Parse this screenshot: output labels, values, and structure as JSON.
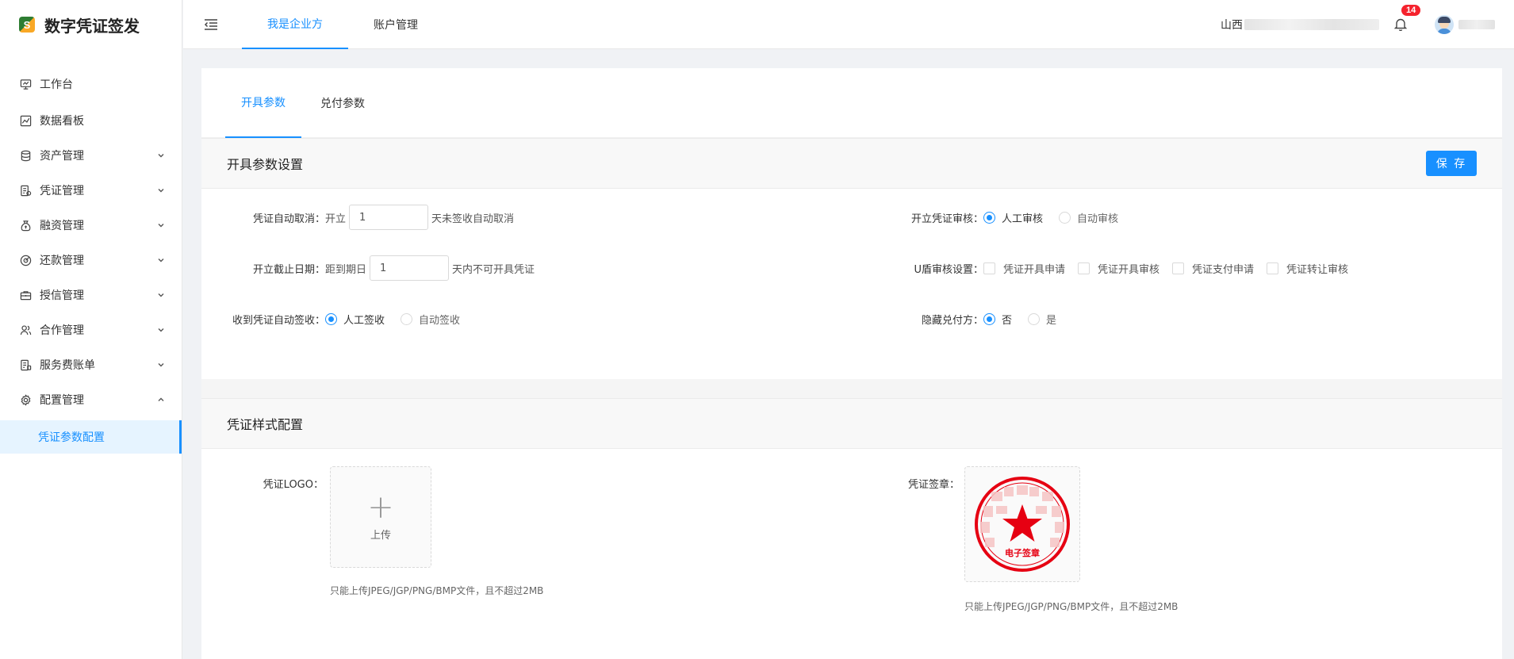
{
  "app": {
    "title": "数字凭证签发"
  },
  "sidebar": {
    "items": [
      {
        "label": "工作台"
      },
      {
        "label": "数据看板"
      },
      {
        "label": "资产管理"
      },
      {
        "label": "凭证管理"
      },
      {
        "label": "融资管理"
      },
      {
        "label": "还款管理"
      },
      {
        "label": "授信管理"
      },
      {
        "label": "合作管理"
      },
      {
        "label": "服务费账单"
      },
      {
        "label": "配置管理"
      }
    ],
    "submenu": {
      "label": "凭证参数配置"
    }
  },
  "header": {
    "tabs": [
      {
        "label": "我是企业方"
      },
      {
        "label": "账户管理"
      }
    ],
    "company_prefix": "山西",
    "notification_count": "14"
  },
  "page": {
    "tabs": [
      {
        "label": "开具参数"
      },
      {
        "label": "兑付参数"
      }
    ],
    "params_section": {
      "title": "开具参数设置",
      "save_label": "保 存",
      "auto_cancel": {
        "label": "凭证自动取消：",
        "prefix": "开立",
        "value": "1",
        "suffix": "天未签收自动取消"
      },
      "deadline": {
        "label": "开立截止日期：",
        "prefix": "距到期日",
        "value": "1",
        "suffix": "天内不可开具凭证"
      },
      "auto_sign": {
        "label": "收到凭证自动签收：",
        "options": [
          "人工签收",
          "自动签收"
        ]
      },
      "open_review": {
        "label": "开立凭证审核：",
        "options": [
          "人工审核",
          "自动审核"
        ]
      },
      "ukey_review": {
        "label": "U盾审核设置：",
        "options": [
          "凭证开具申请",
          "凭证开具审核",
          "凭证支付申请",
          "凭证转让审核"
        ]
      },
      "hide_payer": {
        "label": "隐藏兑付方：",
        "options": [
          "否",
          "是"
        ]
      }
    },
    "style_section": {
      "title": "凭证样式配置",
      "logo": {
        "label": "凭证LOGO：",
        "upload_label": "上传",
        "hint": "只能上传JPEG/JGP/PNG/BMP文件，且不超过2MB"
      },
      "seal": {
        "label": "凭证签章：",
        "seal_text": "电子签章",
        "hint": "只能上传JPEG/JGP/PNG/BMP文件，且不超过2MB"
      }
    }
  },
  "colors": {
    "accent": "#1890ff",
    "seal_red": "#e60012",
    "badge_red": "#f5222d"
  }
}
